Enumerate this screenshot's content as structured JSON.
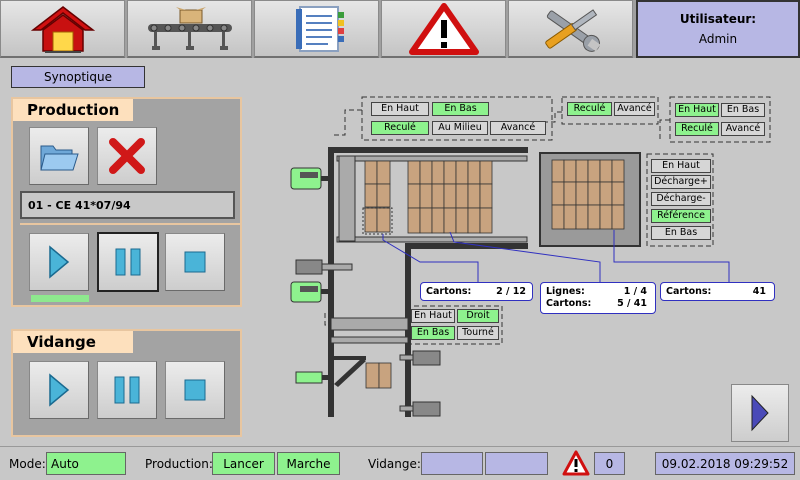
{
  "topbar": {
    "home_icon": "home-icon",
    "conveyor_icon": "conveyor-icon",
    "list_icon": "list-icon",
    "alarm_icon": "warning-icon",
    "tools_icon": "tools-icon",
    "user_label": "Utilisateur:",
    "user_name": "Admin"
  },
  "synoptique_label": "Synoptique",
  "production": {
    "title": "Production",
    "order": "01 - CE 41*07/94"
  },
  "vidange": {
    "title": "Vidange"
  },
  "tags": {
    "a_en_haut": "En Haut",
    "a_en_bas": "En Bas",
    "a_recule": "Reculé",
    "a_au_milieu": "Au Milieu",
    "a_avance": "Avancé",
    "b_recule": "Reculé",
    "b_avance": "Avancé",
    "c_en_haut": "En Haut",
    "c_en_bas": "En Bas",
    "c_recule": "Reculé",
    "c_avance": "Avancé",
    "d_en_haut": "En Haut",
    "d_decharge_plus": "Décharge+",
    "d_decharge_minus": "Décharge-",
    "d_reference": "Référence",
    "d_en_bas": "En Bas",
    "e_en_haut": "En Haut",
    "e_droit": "Droit",
    "e_en_bas": "En Bas",
    "e_tourne": "Tourné"
  },
  "info1": {
    "label": "Cartons:",
    "value": "2  /  12"
  },
  "info2": {
    "l1_label": "Lignes:",
    "l1_value": "1  /  4",
    "l2_label": "Cartons:",
    "l2_value": "5  /  41"
  },
  "info3": {
    "label": "Cartons:",
    "value": "41"
  },
  "status": {
    "mode_label": "Mode:",
    "mode_value": "Auto",
    "production_label": "Production:",
    "production_lancer": "Lancer",
    "production_marche": "Marche",
    "vidange_label": "Vidange:",
    "alarm_count": "0",
    "datetime": "09.02.2018 09:29:52"
  },
  "colors": {
    "green": "#8ef28e",
    "blue_field": "#b7b7e4",
    "panel_header": "#fde0bd",
    "carton": "#c8a37f"
  }
}
